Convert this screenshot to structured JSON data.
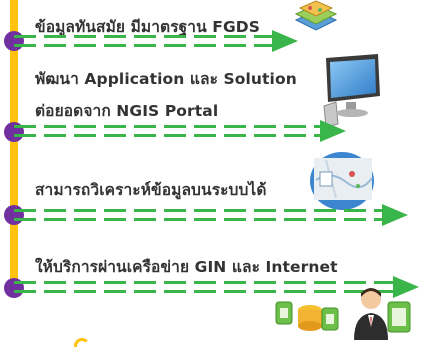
{
  "items": [
    {
      "label": "ข้อมูลทันสมัย มีมาตรฐาน FGDS"
    },
    {
      "label_line1": "พัฒนา Application และ Solution",
      "label_line2": "ต่อยอดจาก NGIS Portal"
    },
    {
      "label": "สามารถวิเคราะห์ข้อมูลบนระบบได้"
    },
    {
      "label": "ให้บริการผ่านเครือข่าย GIN และ Internet"
    }
  ],
  "colors": {
    "timeline": "#ffc20e",
    "dot": "#7030a0",
    "arrow": "#39b54a"
  },
  "icons": [
    "map-layers-icon",
    "monitor-icon",
    "map-chart-icon",
    "data-transfer-icon",
    "user-icon",
    "document-icon"
  ]
}
